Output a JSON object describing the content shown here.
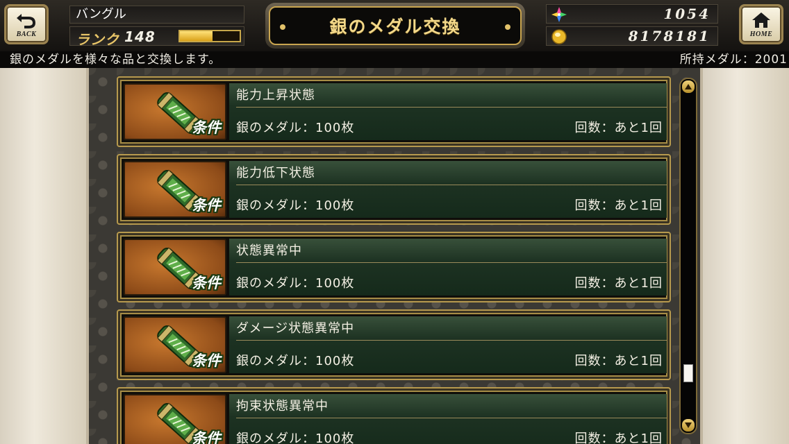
{
  "header": {
    "back_label": "BACK",
    "home_label": "HOME",
    "player_name": "バングル",
    "rank_label": "ランク",
    "rank_value": "148",
    "rank_progress": 0.55,
    "title": "銀のメダル交換",
    "gems": "1054",
    "gold": "8178181"
  },
  "info": {
    "description": "銀のメダルを様々な品と交換します。",
    "owned": "所持メダル：2001"
  },
  "items": [
    {
      "name": "能力上昇状態",
      "badge": "条件",
      "cost": "銀のメダル：100枚",
      "count": "回数：あと1回"
    },
    {
      "name": "能力低下状態",
      "badge": "条件",
      "cost": "銀のメダル：100枚",
      "count": "回数：あと1回"
    },
    {
      "name": "状態異常中",
      "badge": "条件",
      "cost": "銀のメダル：100枚",
      "count": "回数：あと1回"
    },
    {
      "name": "ダメージ状態異常中",
      "badge": "条件",
      "cost": "銀のメダル：100枚",
      "count": "回数：あと1回"
    },
    {
      "name": "拘束状態異常中",
      "badge": "条件",
      "cost": "銀のメダル：100枚",
      "count": "回数：あと1回"
    }
  ],
  "scroll_position": 0.88,
  "icons": {
    "back": "back-arrow-icon",
    "home": "home-icon",
    "gem": "crystal-icon",
    "gold": "gold-coin-icon",
    "item": "scroll-icon"
  }
}
